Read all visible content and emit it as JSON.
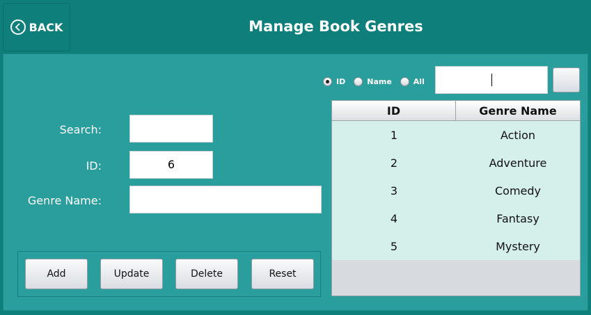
{
  "header": {
    "back_label": "BACK",
    "title": "Manage Book Genres"
  },
  "form": {
    "search_label": "Search:",
    "search_value": "",
    "id_label": "ID:",
    "id_value": "6",
    "genre_label": "Genre Name:",
    "genre_value": ""
  },
  "buttons": {
    "add": "Add",
    "update": "Update",
    "delete": "Delete",
    "reset": "Reset"
  },
  "filter": {
    "options": [
      "ID",
      "Name",
      "All"
    ],
    "selected": "ID",
    "search_value": ""
  },
  "table": {
    "columns": [
      "ID",
      "Genre Name"
    ],
    "rows": [
      {
        "id": "1",
        "name": "Action"
      },
      {
        "id": "2",
        "name": "Adventure"
      },
      {
        "id": "3",
        "name": "Comedy"
      },
      {
        "id": "4",
        "name": "Fantasy"
      },
      {
        "id": "5",
        "name": "Mystery"
      }
    ]
  },
  "colors": {
    "header_bg": "#0f7f7c",
    "panel_bg": "#2a9e9c",
    "table_rows_bg": "#d5efeb"
  },
  "icons": {
    "back": "back-arrow-icon"
  }
}
